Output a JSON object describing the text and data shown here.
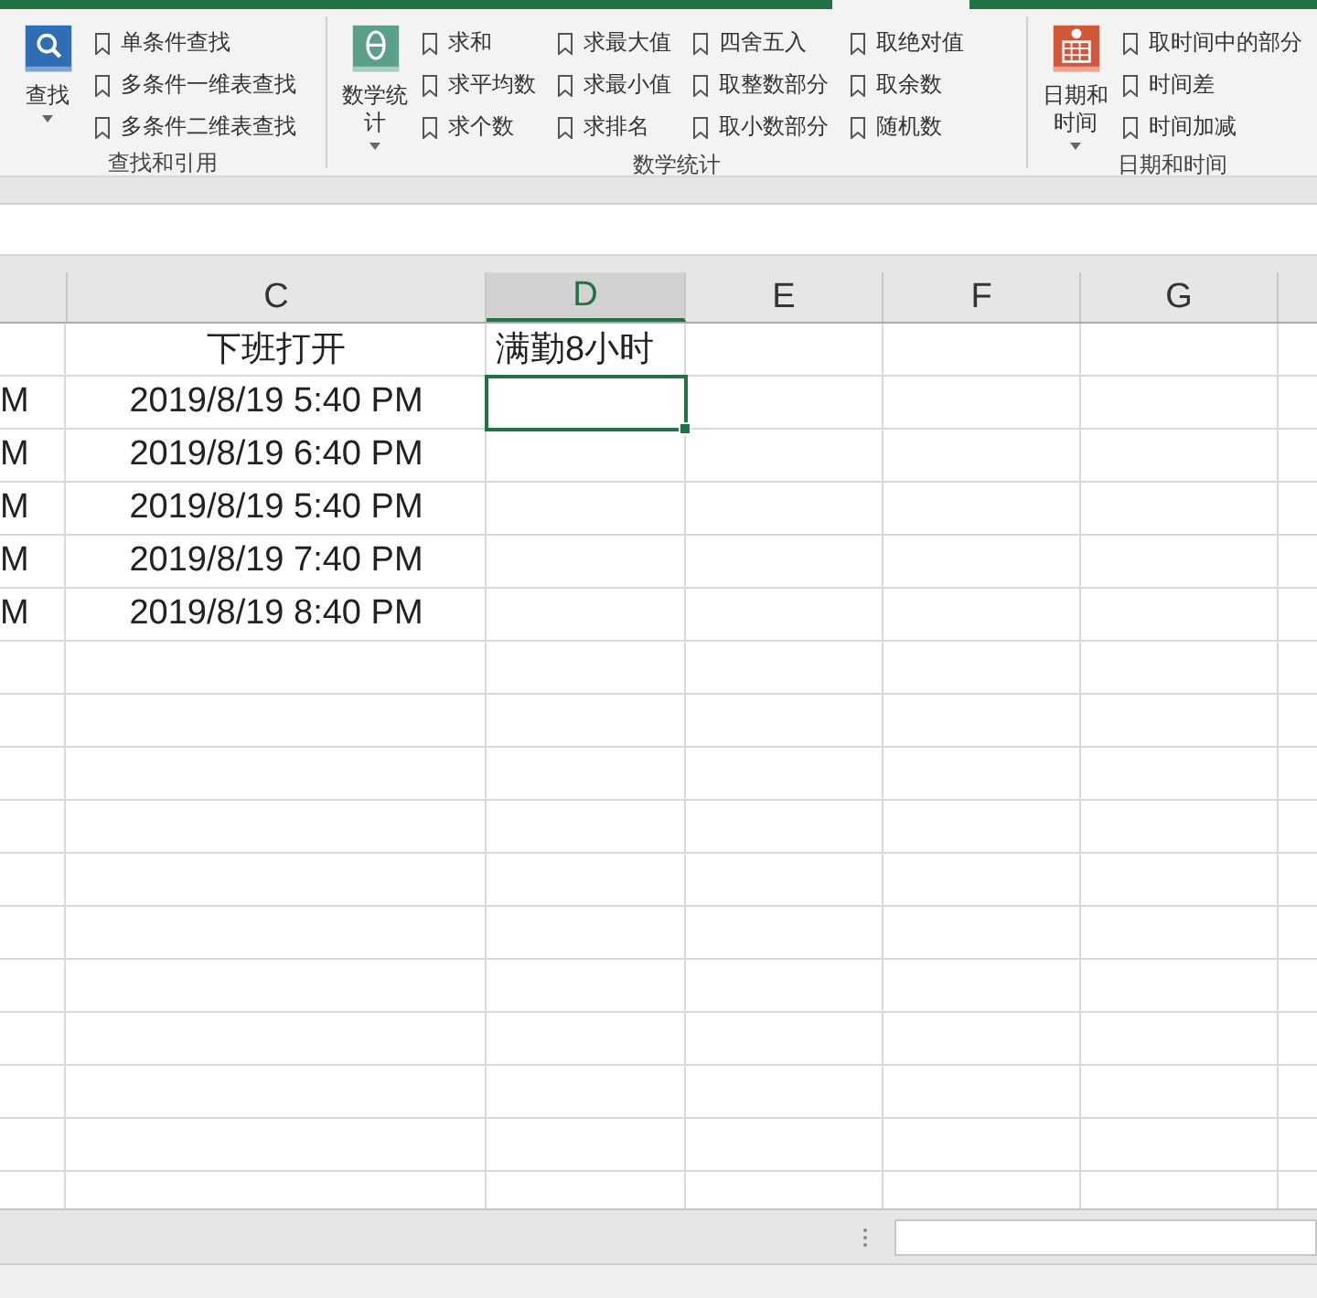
{
  "ribbon": {
    "groups": [
      {
        "label": "查找和引用",
        "big_button": {
          "label": "查找",
          "dropdown": true
        },
        "items": [
          "单条件查找",
          "多条件一维表查找",
          "多条件二维表查找"
        ]
      },
      {
        "label": "数学统计",
        "big_button": {
          "label": "数学统计",
          "dropdown": true
        },
        "items": [
          "求和",
          "求平均数",
          "求个数",
          "求最大值",
          "求最小值",
          "求排名",
          "四舍五入",
          "取整数部分",
          "取小数部分",
          "取绝对值",
          "取余数",
          "随机数"
        ]
      },
      {
        "label": "日期和时间",
        "big_button": {
          "label": "日期和时间",
          "dropdown": true
        },
        "items": [
          "取时间中的部分",
          "时间差",
          "时间加减"
        ]
      }
    ]
  },
  "sheet": {
    "columns": [
      {
        "label": "C",
        "selected": false
      },
      {
        "label": "D",
        "selected": true
      },
      {
        "label": "E",
        "selected": false
      },
      {
        "label": "F",
        "selected": false
      },
      {
        "label": "G",
        "selected": false
      }
    ],
    "header_row": {
      "column_c": "下班打开",
      "column_d": "满勤8小时"
    },
    "rows": [
      {
        "column_b": "M",
        "column_c": "2019/8/19 5:40 PM",
        "d_selected": true
      },
      {
        "column_b": "M",
        "column_c": "2019/8/19 6:40 PM",
        "d_selected": false
      },
      {
        "column_b": "M",
        "column_c": "2019/8/19 5:40 PM",
        "d_selected": false
      },
      {
        "column_b": "M",
        "column_c": "2019/8/19 7:40 PM",
        "d_selected": false
      },
      {
        "column_b": "M",
        "column_c": "2019/8/19 8:40 PM",
        "d_selected": false
      }
    ]
  }
}
